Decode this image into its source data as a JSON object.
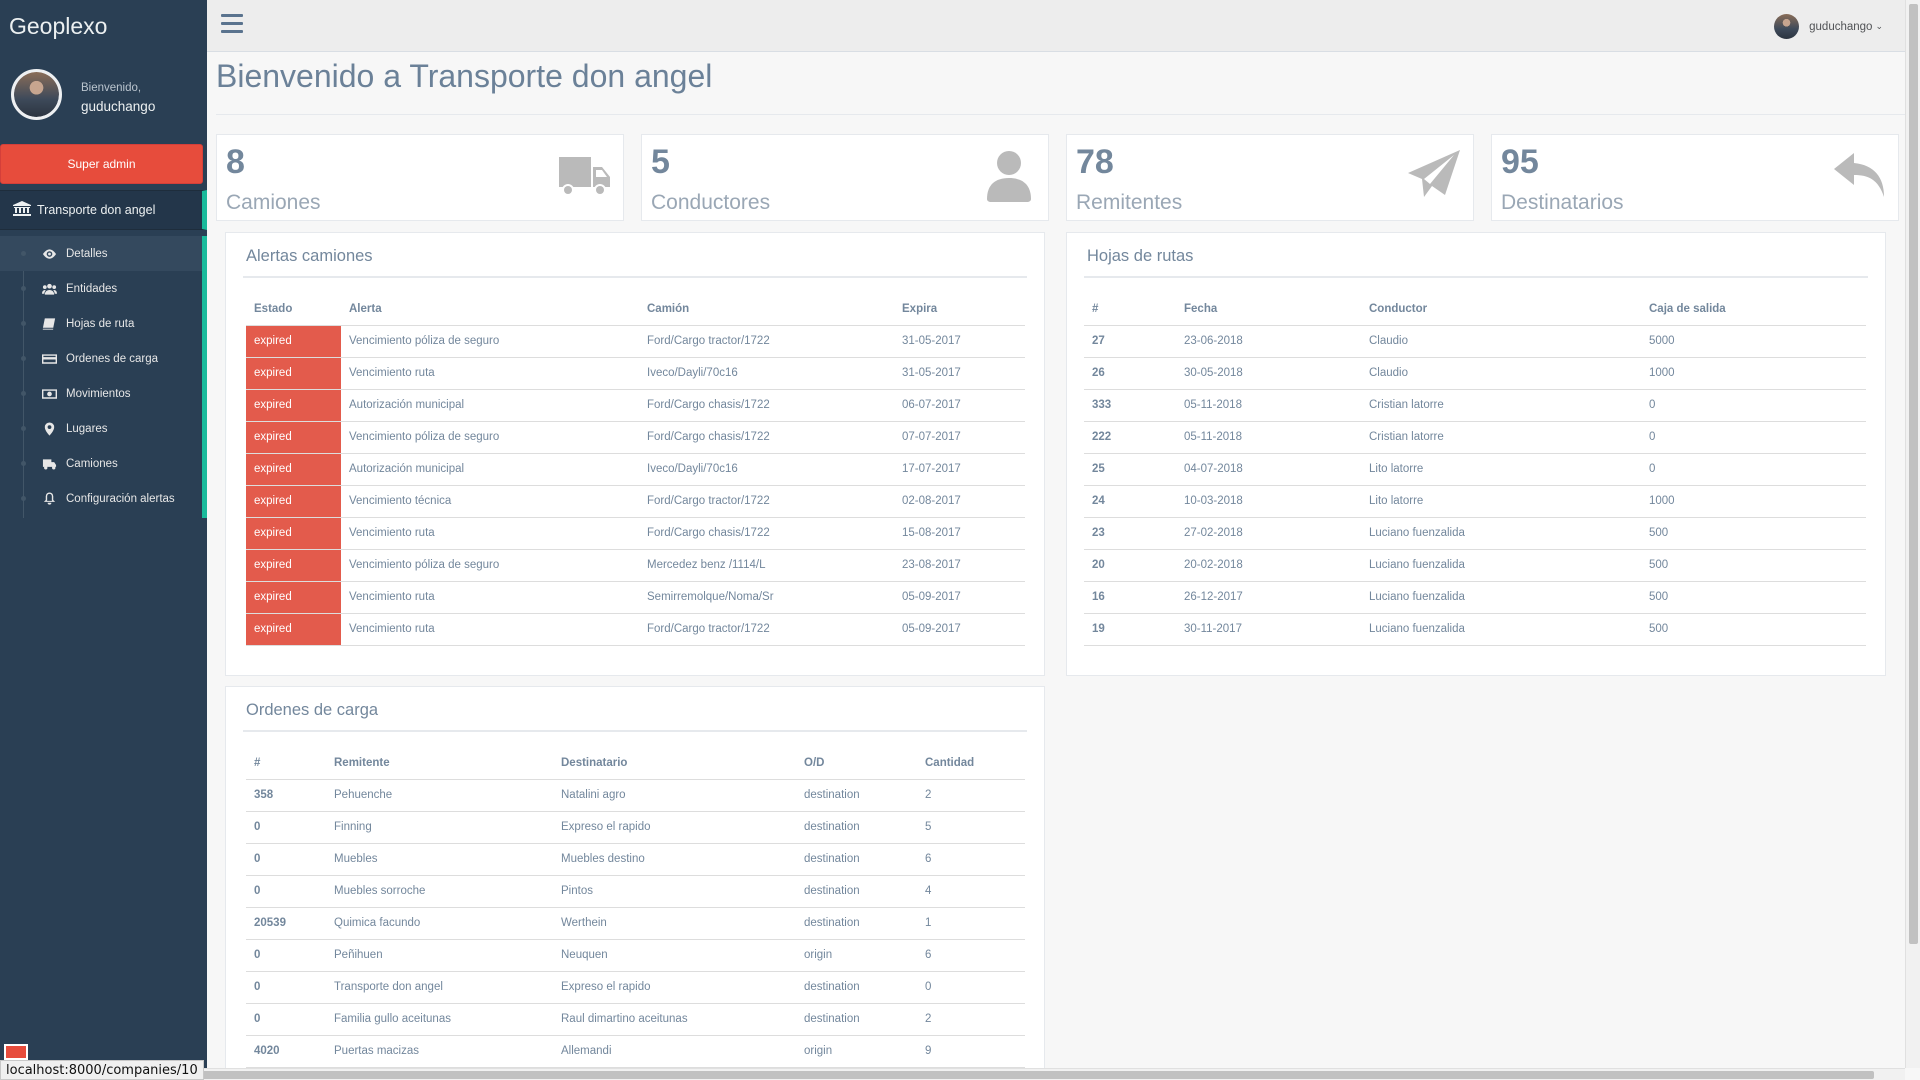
{
  "sidebar": {
    "brand": "Geoplexo",
    "welcome": "Bienvenido,",
    "username": "guduchango",
    "role_button": "Super admin",
    "company": "Transporte don angel",
    "items": [
      {
        "label": "Detalles",
        "icon": "eye-icon"
      },
      {
        "label": "Entidades",
        "icon": "users-icon"
      },
      {
        "label": "Hojas de ruta",
        "icon": "book-icon"
      },
      {
        "label": "Ordenes de carga",
        "icon": "credit-card-icon"
      },
      {
        "label": "Movimientos",
        "icon": "money-icon"
      },
      {
        "label": "Lugares",
        "icon": "map-marker-icon"
      },
      {
        "label": "Camiones",
        "icon": "bus-icon"
      },
      {
        "label": "Configuración alertas",
        "icon": "bell-icon"
      }
    ]
  },
  "topbar": {
    "username": "guduchango"
  },
  "page": {
    "title": "Bienvenido a Transporte don angel"
  },
  "tiles": [
    {
      "count": "8",
      "label": "Camiones",
      "icon": "truck-icon"
    },
    {
      "count": "5",
      "label": "Conductores",
      "icon": "user-icon"
    },
    {
      "count": "78",
      "label": "Remitentes",
      "icon": "paper-plane-icon"
    },
    {
      "count": "95",
      "label": "Destinatarios",
      "icon": "reply-icon"
    }
  ],
  "alerts": {
    "title": "Alertas camiones",
    "headers": [
      "Estado",
      "Alerta",
      "Camión",
      "Expira"
    ],
    "rows": [
      [
        "expired",
        "Vencimiento póliza de seguro",
        "Ford/Cargo tractor/1722",
        "31-05-2017"
      ],
      [
        "expired",
        "Vencimiento ruta",
        "Iveco/Dayli/70c16",
        "31-05-2017"
      ],
      [
        "expired",
        "Autorización municipal",
        "Ford/Cargo chasis/1722",
        "06-07-2017"
      ],
      [
        "expired",
        "Vencimiento póliza de seguro",
        "Ford/Cargo chasis/1722",
        "07-07-2017"
      ],
      [
        "expired",
        "Autorización municipal",
        "Iveco/Dayli/70c16",
        "17-07-2017"
      ],
      [
        "expired",
        "Vencimiento técnica",
        "Ford/Cargo tractor/1722",
        "02-08-2017"
      ],
      [
        "expired",
        "Vencimiento ruta",
        "Ford/Cargo chasis/1722",
        "15-08-2017"
      ],
      [
        "expired",
        "Vencimiento póliza de seguro",
        "Mercedez benz /1114/L",
        "23-08-2017"
      ],
      [
        "expired",
        "Vencimiento ruta",
        "Semirremolque/Noma/Sr",
        "05-09-2017"
      ],
      [
        "expired",
        "Vencimiento ruta",
        "Ford/Cargo tractor/1722",
        "05-09-2017"
      ]
    ]
  },
  "routes": {
    "title": "Hojas de rutas",
    "headers": [
      "#",
      "Fecha",
      "Conductor",
      "Caja de salida"
    ],
    "rows": [
      [
        "27",
        "23-06-2018",
        "Claudio",
        "5000"
      ],
      [
        "26",
        "30-05-2018",
        "Claudio",
        "1000"
      ],
      [
        "333",
        "05-11-2018",
        "Cristian latorre",
        "0"
      ],
      [
        "222",
        "05-11-2018",
        "Cristian latorre",
        "0"
      ],
      [
        "25",
        "04-07-2018",
        "Lito latorre",
        "0"
      ],
      [
        "24",
        "10-03-2018",
        "Lito latorre",
        "1000"
      ],
      [
        "23",
        "27-02-2018",
        "Luciano fuenzalida",
        "500"
      ],
      [
        "20",
        "20-02-2018",
        "Luciano fuenzalida",
        "500"
      ],
      [
        "16",
        "26-12-2017",
        "Luciano fuenzalida",
        "500"
      ],
      [
        "19",
        "30-11-2017",
        "Luciano fuenzalida",
        "500"
      ]
    ]
  },
  "orders": {
    "title": "Ordenes de carga",
    "headers": [
      "#",
      "Remitente",
      "Destinatario",
      "O/D",
      "Cantidad"
    ],
    "rows": [
      [
        "358",
        "Pehuenche",
        "Natalini agro",
        "destination",
        "2"
      ],
      [
        "0",
        "Finning",
        "Expreso el rapido",
        "destination",
        "5"
      ],
      [
        "0",
        "Muebles",
        "Muebles destino",
        "destination",
        "6"
      ],
      [
        "0",
        "Muebles sorroche",
        "Pintos",
        "destination",
        "4"
      ],
      [
        "20539",
        "Quimica facundo",
        "Werthein",
        "destination",
        "1"
      ],
      [
        "0",
        "Peñihuen",
        "Neuquen",
        "origin",
        "6"
      ],
      [
        "0",
        "Transporte don angel",
        "Expreso el rapido",
        "destination",
        "0"
      ],
      [
        "0",
        "Familia gullo aceitunas",
        "Raul dimartino aceitunas",
        "destination",
        "2"
      ],
      [
        "4020",
        "Puertas macizas",
        "Allemandi",
        "origin",
        "9"
      ]
    ]
  },
  "statusbar": {
    "url": "localhost:8000/companies/10"
  },
  "colors": {
    "sidebar": "#2a3f54",
    "accent": "#1abb9c",
    "danger": "#e74c3c"
  }
}
